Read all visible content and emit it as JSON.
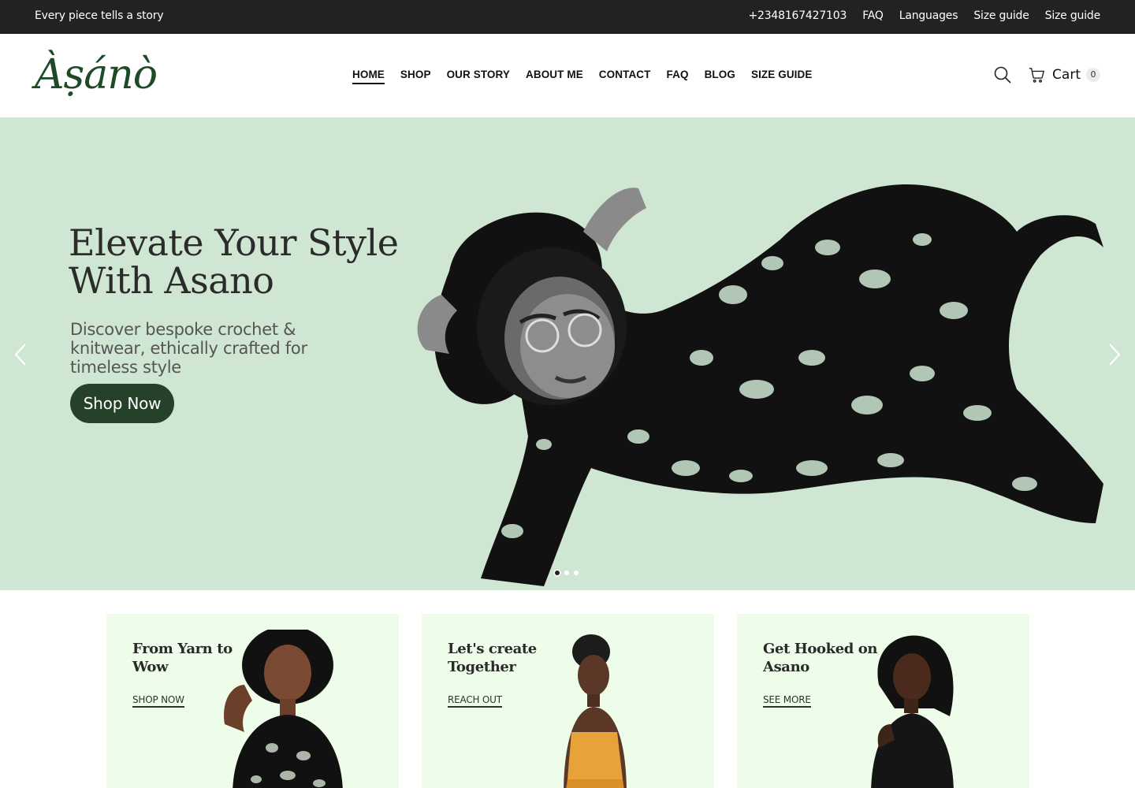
{
  "topbar": {
    "tagline": "Every piece tells a story",
    "links": [
      "+2348167427103",
      "FAQ",
      "Languages",
      "Size guide",
      "Size guide"
    ]
  },
  "header": {
    "logo_text": "Àṣánò",
    "nav": [
      "HOME",
      "SHOP",
      "OUR STORY",
      "ABOUT ME",
      "CONTACT",
      "FAQ",
      "BLOG",
      "SIZE GUIDE"
    ],
    "active_nav": "HOME",
    "cart_label": "Cart",
    "cart_count": "0"
  },
  "hero": {
    "title": "Elevate Your Style With Asano",
    "subtitle": "Discover bespoke crochet & knitwear, ethically crafted for timeless style",
    "button": "Shop Now",
    "slides": 3,
    "active_slide": 1,
    "background": "#cfe6d2"
  },
  "cards": [
    {
      "title": "From Yarn to Wow",
      "cta": "SHOP NOW"
    },
    {
      "title": "Let's create Together",
      "cta": "REACH OUT"
    },
    {
      "title": "Get Hooked on Asano",
      "cta": "SEE MORE"
    }
  ],
  "colors": {
    "topbar": "#222222",
    "brand_green": "#25412a",
    "card_bg": "#edfde9"
  },
  "icons": [
    "search-icon",
    "cart-icon",
    "chevron-left-icon",
    "chevron-right-icon"
  ]
}
